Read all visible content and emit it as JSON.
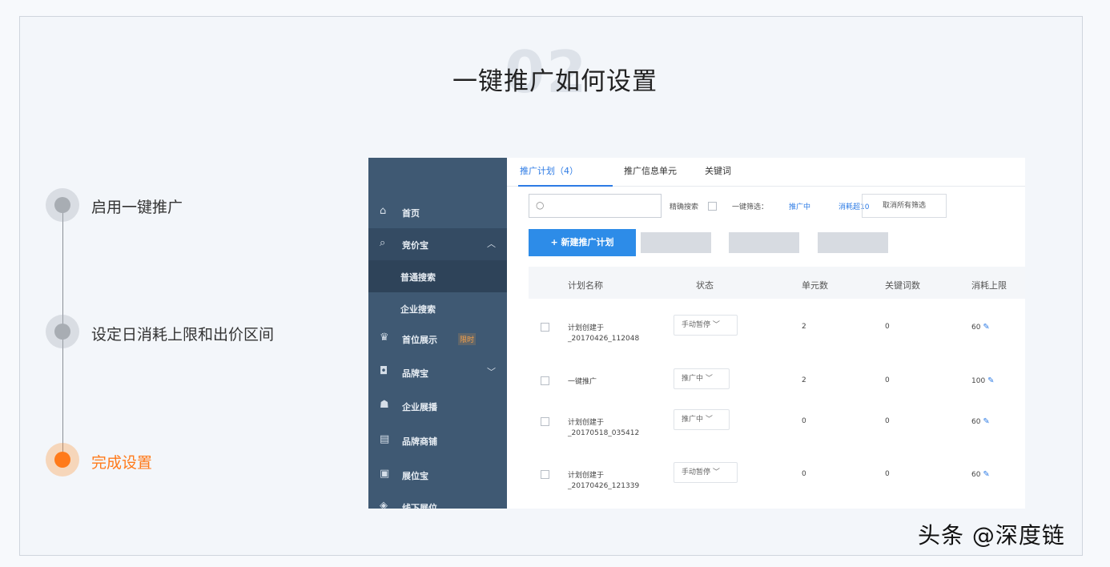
{
  "slide": {
    "number": "02",
    "title": "一键推广如何设置",
    "watermark": "头条 @深度链"
  },
  "steps": [
    {
      "label": "启用一键推广",
      "active": false
    },
    {
      "label": "设定日消耗上限和出价区间",
      "active": false
    },
    {
      "label": "完成设置",
      "active": true
    }
  ],
  "sidebar": {
    "items": [
      {
        "icon": "home-icon",
        "glyph": "⌂",
        "label": "首页"
      },
      {
        "icon": "search-icon",
        "glyph": "⌕",
        "label": "竞价宝"
      },
      {
        "label": "普通搜索"
      },
      {
        "label": "企业搜索"
      },
      {
        "icon": "crown-icon",
        "glyph": "♛",
        "label": "首位展示",
        "badge": "限时"
      },
      {
        "icon": "brand-icon",
        "glyph": "◘",
        "label": "品牌宝"
      },
      {
        "icon": "company-icon",
        "glyph": "☗",
        "label": "企业展播"
      },
      {
        "icon": "store-icon",
        "glyph": "▤",
        "label": "品牌商铺"
      },
      {
        "icon": "box-icon",
        "glyph": "▣",
        "label": "展位宝"
      },
      {
        "icon": "diamond-icon",
        "glyph": "◈",
        "label": "线下展位"
      }
    ]
  },
  "tabs": [
    "推广计划（4）",
    "推广信息单元",
    "关键词"
  ],
  "filters": {
    "search_placeholder": "",
    "exact_search": "精确搜索",
    "quick_filter": "一键筛选：",
    "status_promoting": "推广中",
    "budget_reached": "消耗超10",
    "cancel_filter": "取消所有筛选"
  },
  "actions": {
    "new_plan": "+ 新建推广计划"
  },
  "table": {
    "headers": [
      "计划名称",
      "状态",
      "单元数",
      "关键词数",
      "消耗上限"
    ],
    "rows": [
      {
        "name1": "计划创建于",
        "name2": "_20170426_112048",
        "status": "手动暂停",
        "units": "2",
        "keywords": "0",
        "limit": "60"
      },
      {
        "name1": "一键推广",
        "name2": "",
        "status": "推广中",
        "units": "2",
        "keywords": "0",
        "limit": "100"
      },
      {
        "name1": "计划创建于",
        "name2": "_20170518_035412",
        "status": "推广中",
        "units": "0",
        "keywords": "0",
        "limit": "60"
      },
      {
        "name1": "计划创建于",
        "name2": "_20170426_121339",
        "status": "手动暂停",
        "units": "0",
        "keywords": "0",
        "limit": "60"
      }
    ]
  },
  "colors": {
    "sidebar": "#3f5973",
    "primary": "#2d8ce8",
    "active_step": "#ff7a1a"
  }
}
